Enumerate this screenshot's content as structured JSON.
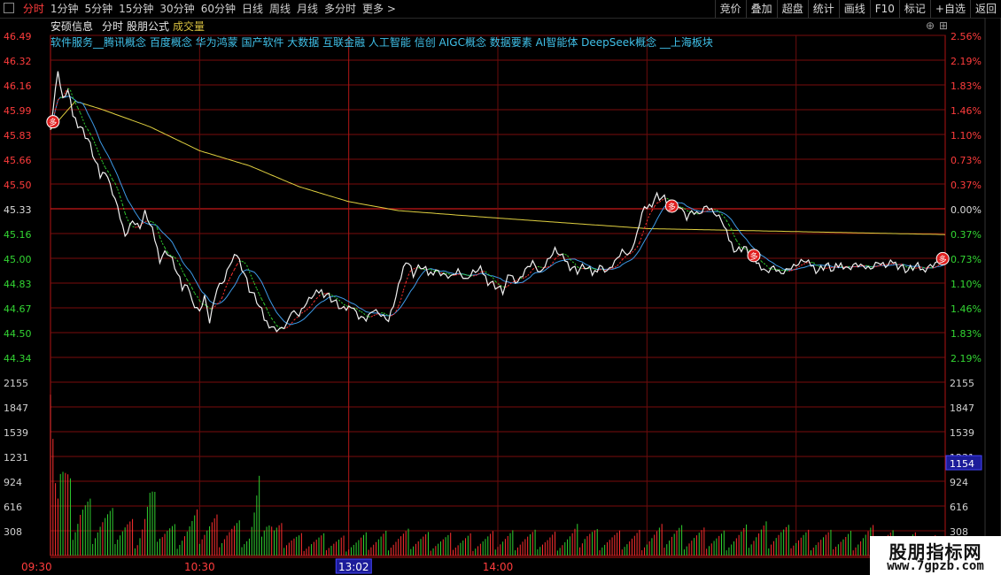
{
  "toolbar": {
    "periods": [
      "分时",
      "1分钟",
      "5分钟",
      "15分钟",
      "30分钟",
      "60分钟",
      "日线",
      "周线",
      "月线",
      "多分时",
      "更多 >"
    ],
    "active": "分时",
    "right_buttons": [
      "竞价",
      "叠加",
      "超盘",
      "统计",
      "画线",
      "F10",
      "标记",
      "+自选",
      "返回"
    ]
  },
  "chart_data": {
    "type": "line",
    "header": {
      "stock": "安硕信息",
      "view": "分时",
      "formula": "股朋公式",
      "indicator": "成交量"
    },
    "concepts": "软件服务__腾讯概念 百度概念 华为鸿蒙 国产软件 大数据 互联金融 人工智能 信创 AIGC概念 数据要素 AI智能体 DeepSeek概念 __上海板块",
    "price_axis": {
      "ticks": [
        "46.49",
        "46.32",
        "46.16",
        "45.99",
        "45.83",
        "45.66",
        "45.50",
        "45.33",
        "45.16",
        "45.00",
        "44.83",
        "44.67",
        "44.50",
        "44.34"
      ],
      "ylim": [
        44.34,
        46.49
      ],
      "ref": 45.33
    },
    "pct_axis": [
      "2.56%",
      "2.19%",
      "1.83%",
      "1.46%",
      "1.10%",
      "0.73%",
      "0.37%",
      "0.00%",
      "0.37%",
      "0.73%",
      "1.10%",
      "1.46%",
      "1.83%",
      "2.19%"
    ],
    "vol_axis": {
      "ticks": [
        "2155",
        "1847",
        "1539",
        "1231",
        "924",
        "616",
        "308"
      ],
      "max": 2155,
      "highlight": "1154"
    },
    "time_labels": [
      "09:30",
      "10:30",
      "13:02",
      "14:00"
    ],
    "price_keys": [
      [
        0,
        45.86
      ],
      [
        3,
        46.25
      ],
      [
        5,
        46.05
      ],
      [
        7,
        46.12
      ],
      [
        9,
        45.95
      ],
      [
        12,
        45.88
      ],
      [
        15,
        45.8
      ],
      [
        17,
        45.7
      ],
      [
        20,
        45.55
      ],
      [
        22,
        45.6
      ],
      [
        25,
        45.45
      ],
      [
        27,
        45.35
      ],
      [
        30,
        45.15
      ],
      [
        33,
        45.25
      ],
      [
        36,
        45.2
      ],
      [
        38,
        45.3
      ],
      [
        41,
        45.18
      ],
      [
        44,
        45.0
      ],
      [
        47,
        45.05
      ],
      [
        50,
        44.95
      ],
      [
        53,
        44.8
      ],
      [
        55,
        44.85
      ],
      [
        57,
        44.72
      ],
      [
        60,
        44.65
      ],
      [
        62,
        44.75
      ],
      [
        64,
        44.58
      ],
      [
        67,
        44.8
      ],
      [
        70,
        44.85
      ],
      [
        72,
        44.95
      ],
      [
        75,
        45.02
      ],
      [
        77,
        44.95
      ],
      [
        80,
        44.8
      ],
      [
        83,
        44.72
      ],
      [
        86,
        44.6
      ],
      [
        89,
        44.55
      ],
      [
        92,
        44.53
      ],
      [
        95,
        44.56
      ],
      [
        97,
        44.65
      ],
      [
        100,
        44.62
      ],
      [
        103,
        44.7
      ],
      [
        106,
        44.75
      ],
      [
        109,
        44.78
      ],
      [
        112,
        44.75
      ],
      [
        115,
        44.7
      ],
      [
        118,
        44.65
      ],
      [
        121,
        44.7
      ],
      [
        124,
        44.62
      ],
      [
        127,
        44.6
      ],
      [
        130,
        44.66
      ],
      [
        133,
        44.62
      ],
      [
        136,
        44.58
      ],
      [
        138,
        44.68
      ],
      [
        140,
        44.8
      ],
      [
        143,
        45.0
      ],
      [
        146,
        44.9
      ],
      [
        149,
        44.95
      ],
      [
        152,
        44.9
      ],
      [
        155,
        44.93
      ],
      [
        158,
        44.9
      ],
      [
        161,
        44.88
      ],
      [
        164,
        44.92
      ],
      [
        167,
        44.85
      ],
      [
        170,
        44.9
      ],
      [
        173,
        44.92
      ],
      [
        176,
        44.85
      ],
      [
        179,
        44.82
      ],
      [
        182,
        44.78
      ],
      [
        185,
        44.9
      ],
      [
        188,
        44.85
      ],
      [
        191,
        44.93
      ],
      [
        194,
        44.98
      ],
      [
        197,
        44.9
      ],
      [
        200,
        44.98
      ],
      [
        203,
        45.05
      ],
      [
        206,
        45.0
      ],
      [
        209,
        44.95
      ],
      [
        212,
        44.92
      ],
      [
        215,
        44.95
      ],
      [
        218,
        44.9
      ],
      [
        221,
        44.96
      ],
      [
        224,
        44.92
      ],
      [
        227,
        44.98
      ],
      [
        230,
        45.05
      ],
      [
        233,
        45.02
      ],
      [
        236,
        45.15
      ],
      [
        238,
        45.3
      ],
      [
        241,
        45.35
      ],
      [
        244,
        45.42
      ],
      [
        247,
        45.4
      ],
      [
        250,
        45.32
      ],
      [
        253,
        45.37
      ],
      [
        256,
        45.28
      ],
      [
        258,
        45.32
      ],
      [
        261,
        45.3
      ],
      [
        264,
        45.35
      ],
      [
        267,
        45.3
      ],
      [
        270,
        45.25
      ],
      [
        273,
        45.12
      ],
      [
        276,
        45.05
      ],
      [
        279,
        45.08
      ],
      [
        282,
        45.0
      ],
      [
        285,
        44.97
      ],
      [
        288,
        44.92
      ],
      [
        291,
        44.95
      ],
      [
        294,
        44.9
      ],
      [
        297,
        44.93
      ],
      [
        300,
        44.95
      ],
      [
        303,
        44.98
      ],
      [
        306,
        44.95
      ],
      [
        309,
        44.92
      ],
      [
        312,
        44.96
      ],
      [
        315,
        44.92
      ],
      [
        318,
        44.97
      ],
      [
        321,
        44.94
      ],
      [
        324,
        44.97
      ],
      [
        327,
        44.95
      ],
      [
        330,
        44.93
      ],
      [
        333,
        44.97
      ],
      [
        336,
        44.94
      ],
      [
        339,
        44.97
      ],
      [
        342,
        44.95
      ],
      [
        345,
        44.92
      ],
      [
        348,
        44.95
      ],
      [
        351,
        44.93
      ],
      [
        354,
        44.96
      ],
      [
        357,
        44.98
      ],
      [
        360,
        45.0
      ]
    ],
    "avg_keys": [
      [
        0,
        45.86
      ],
      [
        10,
        46.05
      ],
      [
        20,
        46.0
      ],
      [
        40,
        45.88
      ],
      [
        60,
        45.72
      ],
      [
        80,
        45.62
      ],
      [
        100,
        45.48
      ],
      [
        120,
        45.38
      ],
      [
        140,
        45.32
      ],
      [
        180,
        45.27
      ],
      [
        240,
        45.2
      ],
      [
        300,
        45.18
      ],
      [
        360,
        45.16
      ]
    ],
    "vol_keys": [
      [
        0,
        2000
      ],
      [
        2,
        900
      ],
      [
        4,
        1320
      ],
      [
        6,
        1000
      ],
      [
        9,
        620
      ],
      [
        12,
        720
      ],
      [
        16,
        580
      ],
      [
        20,
        560
      ],
      [
        25,
        460
      ],
      [
        30,
        420
      ],
      [
        35,
        340
      ],
      [
        40,
        760
      ],
      [
        45,
        400
      ],
      [
        50,
        320
      ],
      [
        60,
        460
      ],
      [
        70,
        400
      ],
      [
        80,
        300
      ],
      [
        85,
        940
      ],
      [
        90,
        350
      ],
      [
        100,
        230
      ],
      [
        120,
        200
      ],
      [
        140,
        270
      ],
      [
        160,
        220
      ],
      [
        175,
        230
      ],
      [
        180,
        240
      ],
      [
        190,
        270
      ],
      [
        200,
        230
      ],
      [
        210,
        270
      ],
      [
        215,
        360
      ],
      [
        220,
        270
      ],
      [
        230,
        240
      ],
      [
        240,
        270
      ],
      [
        250,
        330
      ],
      [
        260,
        280
      ],
      [
        270,
        250
      ],
      [
        280,
        300
      ],
      [
        290,
        360
      ],
      [
        300,
        270
      ],
      [
        320,
        240
      ],
      [
        330,
        300
      ],
      [
        345,
        230
      ],
      [
        360,
        200
      ]
    ],
    "marker_minutes": [
      1,
      250,
      283,
      359
    ]
  }
}
